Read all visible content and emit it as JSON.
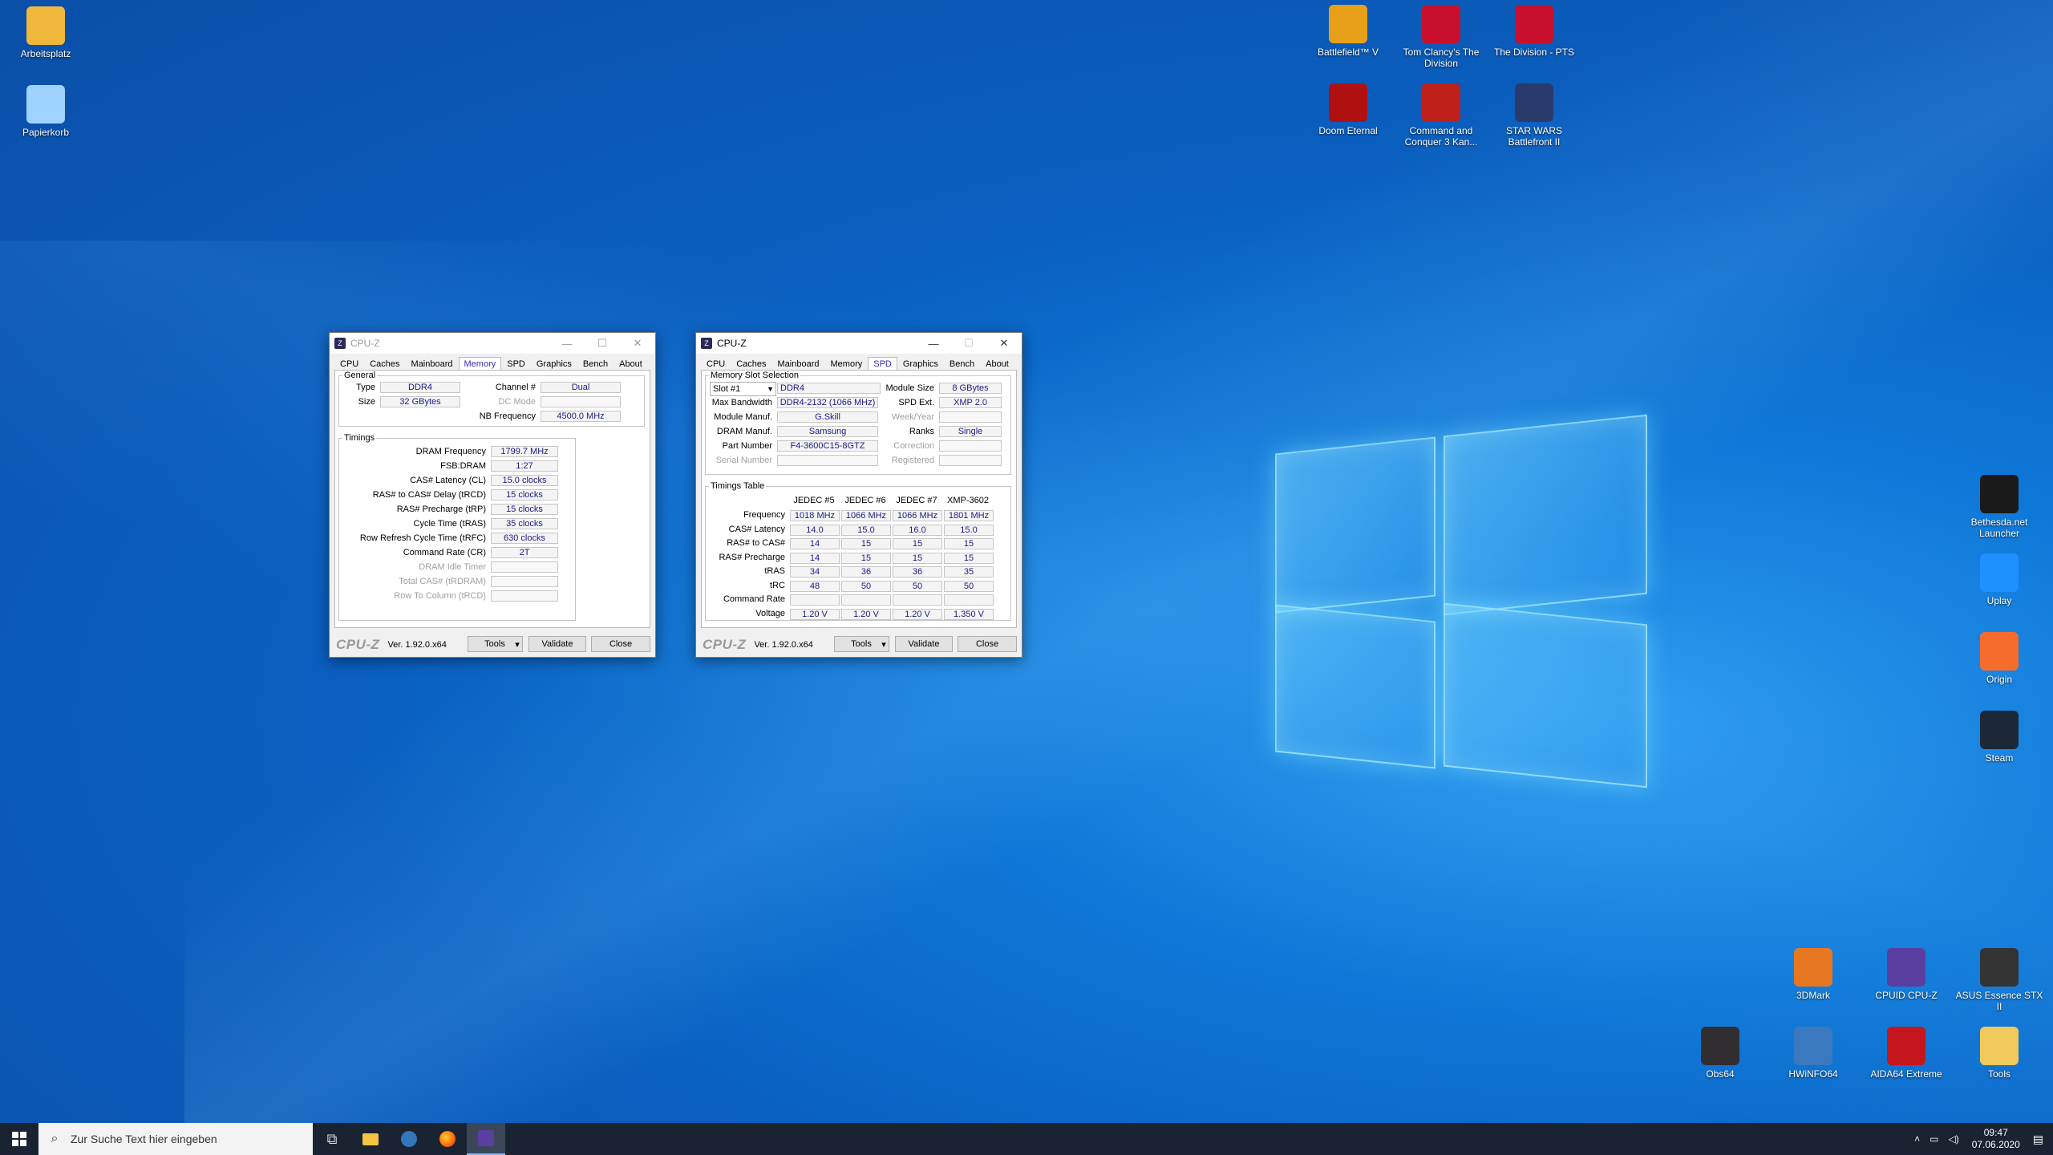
{
  "desktop_icons_left": [
    {
      "label": "Arbeitsplatz",
      "icon": "folder-icon",
      "color": "#f0b83a"
    },
    {
      "label": "Papierkorb",
      "icon": "recycle-bin-icon",
      "color": "#9fd3ff"
    }
  ],
  "desktop_icons_top": [
    {
      "label": "Battlefield™ V",
      "icon": "battlefield-v-icon",
      "color": "#e8a019"
    },
    {
      "label": "Tom Clancy's The Division",
      "icon": "division-icon",
      "color": "#c8102e"
    },
    {
      "label": "The Division - PTS",
      "icon": "division-pts-icon",
      "color": "#c8102e"
    },
    {
      "label": "Doom Eternal",
      "icon": "doom-eternal-icon",
      "color": "#b01010"
    },
    {
      "label": "Command and Conquer 3 Kan...",
      "icon": "command-conquer-icon",
      "color": "#c0201a"
    },
    {
      "label": "STAR WARS Battlefront II",
      "icon": "star-wars-icon",
      "color": "#2a3a6a"
    }
  ],
  "desktop_icons_right": [
    {
      "label": "Bethesda.net Launcher",
      "icon": "bethesda-icon",
      "color": "#1a1a1a"
    },
    {
      "label": "Uplay",
      "icon": "uplay-icon",
      "color": "#1e90ff"
    },
    {
      "label": "Origin",
      "icon": "origin-icon",
      "color": "#f56c2d"
    },
    {
      "label": "Steam",
      "icon": "steam-icon",
      "color": "#1b2838"
    }
  ],
  "desktop_icons_bottom": [
    {
      "label": "3DMark",
      "icon": "3dmark-icon",
      "color": "#e87722"
    },
    {
      "label": "CPUID CPU-Z",
      "icon": "cpuz-icon",
      "color": "#5a3ea0"
    },
    {
      "label": "ASUS Essence STX II",
      "icon": "asus-icon",
      "color": "#333333"
    },
    {
      "label": "Obs64",
      "icon": "obs-icon",
      "color": "#302e31"
    },
    {
      "label": "HWiNFO64",
      "icon": "hwinfo-icon",
      "color": "#3a78c0"
    },
    {
      "label": "AIDA64 Extreme",
      "icon": "aida64-icon",
      "color": "#c4161c"
    },
    {
      "label": "Tools",
      "icon": "folder-icon",
      "color": "#f0c95a"
    }
  ],
  "cpuz_memory": {
    "title": "CPU-Z",
    "tabs": [
      "CPU",
      "Caches",
      "Mainboard",
      "Memory",
      "SPD",
      "Graphics",
      "Bench",
      "About"
    ],
    "active_tab": "Memory",
    "general": {
      "legend": "General",
      "type_label": "Type",
      "type_value": "DDR4",
      "size_label": "Size",
      "size_value": "32 GBytes",
      "channel_label": "Channel #",
      "channel_value": "Dual",
      "dcmode_label": "DC Mode",
      "dcmode_value": "",
      "nbfreq_label": "NB Frequency",
      "nbfreq_value": "4500.0 MHz"
    },
    "timings": {
      "legend": "Timings",
      "rows": [
        {
          "label": "DRAM Frequency",
          "value": "1799.7 MHz",
          "dim": false
        },
        {
          "label": "FSB:DRAM",
          "value": "1:27",
          "dim": false
        },
        {
          "label": "CAS# Latency (CL)",
          "value": "15.0 clocks",
          "dim": false
        },
        {
          "label": "RAS# to CAS# Delay (tRCD)",
          "value": "15 clocks",
          "dim": false
        },
        {
          "label": "RAS# Precharge (tRP)",
          "value": "15 clocks",
          "dim": false
        },
        {
          "label": "Cycle Time (tRAS)",
          "value": "35 clocks",
          "dim": false
        },
        {
          "label": "Row Refresh Cycle Time (tRFC)",
          "value": "630 clocks",
          "dim": false
        },
        {
          "label": "Command Rate (CR)",
          "value": "2T",
          "dim": false
        },
        {
          "label": "DRAM Idle Timer",
          "value": "",
          "dim": true
        },
        {
          "label": "Total CAS# (tRDRAM)",
          "value": "",
          "dim": true
        },
        {
          "label": "Row To Column (tRCD)",
          "value": "",
          "dim": true
        }
      ]
    },
    "footer": {
      "brand": "CPU-Z",
      "version": "Ver. 1.92.0.x64",
      "tools": "Tools",
      "validate": "Validate",
      "close": "Close"
    }
  },
  "cpuz_spd": {
    "title": "CPU-Z",
    "tabs": [
      "CPU",
      "Caches",
      "Mainboard",
      "Memory",
      "SPD",
      "Graphics",
      "Bench",
      "About"
    ],
    "active_tab": "SPD",
    "slot": {
      "legend": "Memory Slot Selection",
      "selected": "Slot #1",
      "type": "DDR4",
      "module_size_label": "Module Size",
      "module_size": "8 GBytes",
      "max_bw_label": "Max Bandwidth",
      "max_bw": "DDR4-2132 (1066 MHz)",
      "spd_ext_label": "SPD Ext.",
      "spd_ext": "XMP 2.0",
      "module_manuf_label": "Module Manuf.",
      "module_manuf": "G.Skill",
      "week_year_label": "Week/Year",
      "week_year": "",
      "dram_manuf_label": "DRAM Manuf.",
      "dram_manuf": "Samsung",
      "ranks_label": "Ranks",
      "ranks": "Single",
      "part_number_label": "Part Number",
      "part_number": "F4-3600C15-8GTZ",
      "correction_label": "Correction",
      "correction": "",
      "serial_label": "Serial Number",
      "serial": "",
      "registered_label": "Registered",
      "registered": ""
    },
    "timings_table": {
      "legend": "Timings Table",
      "columns": [
        "JEDEC #5",
        "JEDEC #6",
        "JEDEC #7",
        "XMP-3602"
      ],
      "rows": [
        {
          "label": "Frequency",
          "values": [
            "1018 MHz",
            "1066 MHz",
            "1066 MHz",
            "1801 MHz"
          ]
        },
        {
          "label": "CAS# Latency",
          "values": [
            "14.0",
            "15.0",
            "16.0",
            "15.0"
          ]
        },
        {
          "label": "RAS# to CAS#",
          "values": [
            "14",
            "15",
            "15",
            "15"
          ]
        },
        {
          "label": "RAS# Precharge",
          "values": [
            "14",
            "15",
            "15",
            "15"
          ]
        },
        {
          "label": "tRAS",
          "values": [
            "34",
            "36",
            "36",
            "35"
          ]
        },
        {
          "label": "tRC",
          "values": [
            "48",
            "50",
            "50",
            "50"
          ]
        },
        {
          "label": "Command Rate",
          "values": [
            "",
            "",
            "",
            ""
          ]
        },
        {
          "label": "Voltage",
          "values": [
            "1.20 V",
            "1.20 V",
            "1.20 V",
            "1.350 V"
          ]
        }
      ]
    },
    "footer": {
      "brand": "CPU-Z",
      "version": "Ver. 1.92.0.x64",
      "tools": "Tools",
      "validate": "Validate",
      "close": "Close"
    }
  },
  "taskbar": {
    "search_placeholder": "Zur Suche Text hier eingeben",
    "time": "09:47",
    "date": "07.06.2020"
  }
}
